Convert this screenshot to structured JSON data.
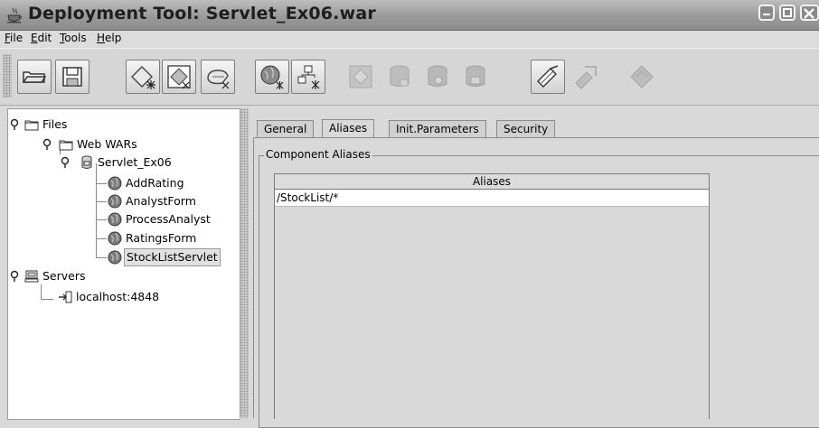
{
  "window": {
    "title": "Deployment Tool: Servlet_Ex06.war",
    "app_icon": "java-cup-icon",
    "controls": [
      "minimize-icon",
      "maximize-icon",
      "close-icon"
    ]
  },
  "menu": [
    {
      "label": "File",
      "mnemonic": "F"
    },
    {
      "label": "Edit",
      "mnemonic": "E"
    },
    {
      "label": "Tools",
      "mnemonic": "T"
    },
    {
      "label": "Help",
      "mnemonic": "H"
    }
  ],
  "toolbar": {
    "buttons": [
      {
        "name": "open-icon",
        "enabled": true
      },
      {
        "name": "save-icon",
        "enabled": true
      },
      {
        "name": "new-application-icon",
        "enabled": true
      },
      {
        "name": "new-module-icon",
        "enabled": true
      },
      {
        "name": "new-connector-icon",
        "enabled": true
      },
      {
        "name": "new-web-component-icon",
        "enabled": true
      },
      {
        "name": "new-hierarchy-icon",
        "enabled": true
      },
      {
        "name": "disabled-tool-icon-1",
        "enabled": false
      },
      {
        "name": "disabled-database-icon-1",
        "enabled": false
      },
      {
        "name": "disabled-database-icon-2",
        "enabled": false
      },
      {
        "name": "disabled-database-icon-3",
        "enabled": false
      },
      {
        "name": "verify-icon",
        "enabled": true
      },
      {
        "name": "deploy-icon",
        "enabled": false
      },
      {
        "name": "undeploy-icon",
        "enabled": false
      }
    ]
  },
  "tree": {
    "files": "Files",
    "web_wars": "Web WARs",
    "war": "Servlet_Ex06",
    "components": [
      "AddRating",
      "AnalystForm",
      "ProcessAnalyst",
      "RatingsForm",
      "StockListServlet"
    ],
    "selected_component": "StockListServlet",
    "servers": "Servers",
    "server": "localhost:4848"
  },
  "tabs": [
    {
      "label": "General",
      "active": false
    },
    {
      "label": "Aliases",
      "active": true
    },
    {
      "label": "Init.Parameters",
      "active": false
    },
    {
      "label": "Security",
      "active": false
    }
  ],
  "aliases_panel": {
    "group_title": "Component Aliases",
    "column_header": "Aliases",
    "rows": [
      "/StockList/*"
    ]
  }
}
